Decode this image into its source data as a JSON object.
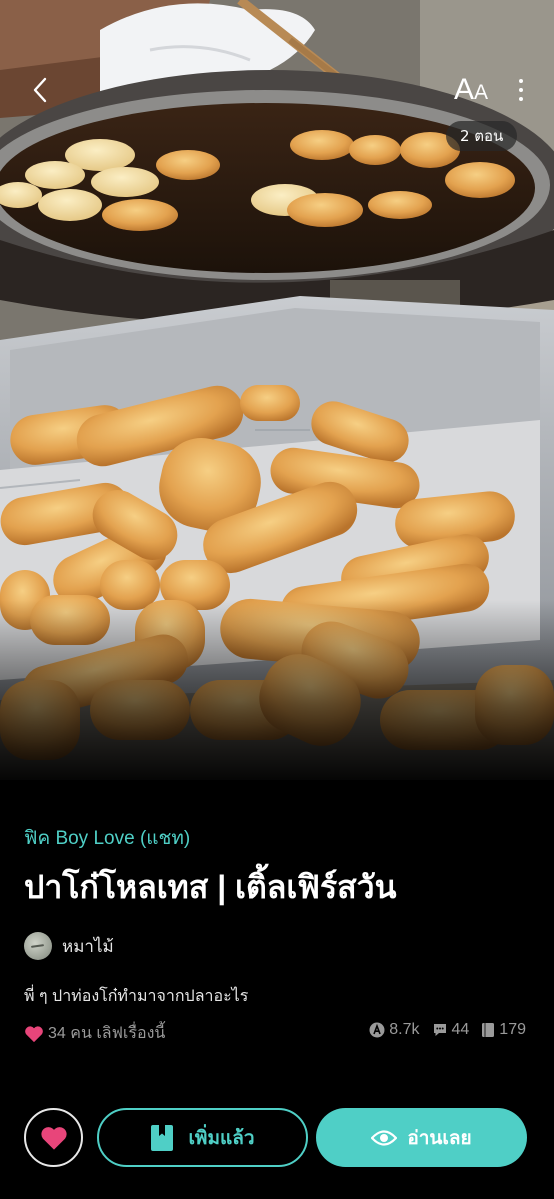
{
  "header": {
    "font_size_label_big": "A",
    "font_size_label_small": "A",
    "episode_count": "2 ตอน"
  },
  "story": {
    "genre": "ฟิค Boy Love (แชท)",
    "title": "ปาโก๋โหลเทส | เติ้ลเฟิร์สวัน",
    "author": "หมาไม้",
    "synopsis": "พี่ ๆ ปาท่องโก๋ทำมาจากปลาอะไร"
  },
  "engagement": {
    "likes_text": "34 คน เลิฟเรื่องนี้",
    "views": "8.7k",
    "comments": "44",
    "chapters": "179"
  },
  "actions": {
    "library_label": "เพิ่มแล้ว",
    "read_label": "อ่านเลย"
  },
  "colors": {
    "accent": "#4fcfc6",
    "heart": "#e8457a",
    "background": "#000000"
  },
  "icons": [
    "back-icon",
    "font-size-icon",
    "more-vertical-icon",
    "heart-icon",
    "bookmark-icon",
    "eye-icon",
    "views-icon",
    "comment-icon",
    "chapter-icon"
  ]
}
